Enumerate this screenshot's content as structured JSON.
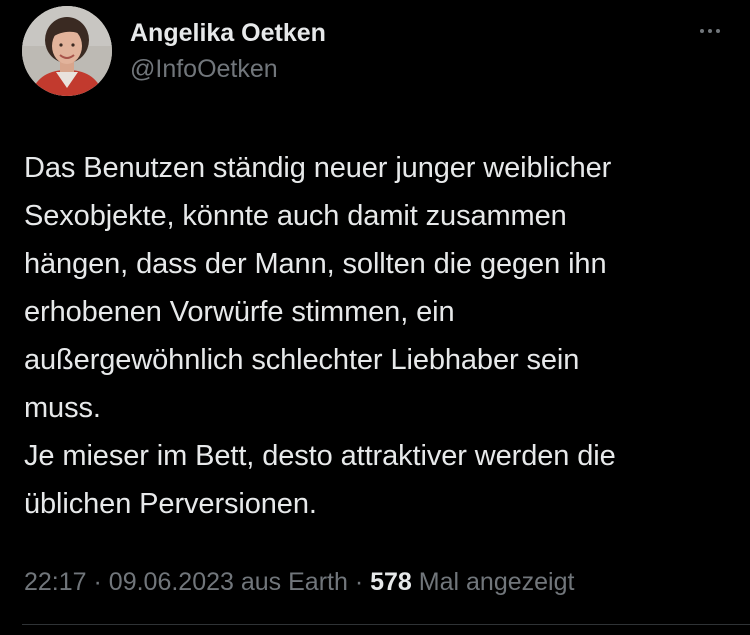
{
  "author": {
    "display_name": "Angelika Oetken",
    "handle": "@InfoOetken",
    "avatar_icon": "profile-photo"
  },
  "more_icon": "more-horizontal-icon",
  "tweet": {
    "text": "Das Benutzen ständig neuer junger weiblicher\nSexobjekte, könnte auch damit zusammen\nhängen, dass der Mann, sollten die gegen ihn\nerhobenen Vorwürfe stimmen, ein\naußergewöhnlich schlechter Liebhaber sein\nmuss.\nJe mieser im Bett, desto attraktiver werden die\nüblichen Perversionen."
  },
  "meta": {
    "time": "22:17",
    "separator": "·",
    "date": "09.06.2023",
    "source": "aus Earth",
    "views_count": "578",
    "views_label": "Mal angezeigt"
  },
  "colors": {
    "background": "#000000",
    "primary_text": "#e7e9ea",
    "secondary_text": "#71767b",
    "divider": "#2f3336"
  }
}
